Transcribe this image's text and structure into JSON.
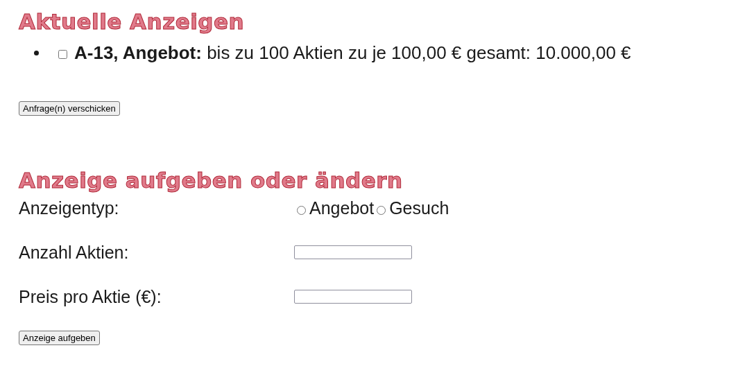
{
  "current_ads": {
    "title": "Aktuelle Anzeigen",
    "items": [
      {
        "text": "**A-13, Angebot:** bis zu 100 Aktien zu je 100,00 € gesamt: 10.000,00 €",
        "checked": false
      }
    ],
    "button": "Anfrage(n) verschicken"
  },
  "new_ad": {
    "title": "Anzeige aufgeben oder ändern",
    "type_field": {
      "label": "Anzeigentyp:",
      "options": [
        {
          "label": "Angebot",
          "selected": false
        },
        {
          "label": "Gesuch",
          "selected": false
        }
      ]
    },
    "fields": [
      {
        "label": "Anzahl Aktien:"
      },
      {
        "label": "Preis pro Aktie (€):"
      }
    ],
    "button": "Anzeige aufgeben"
  }
}
